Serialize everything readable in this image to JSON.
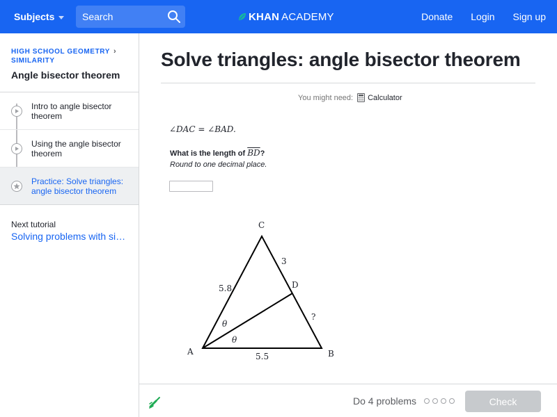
{
  "header": {
    "subjects_label": "Subjects",
    "search_placeholder": "Search",
    "logo_khan": "KHAN",
    "logo_academy": "ACADEMY",
    "donate": "Donate",
    "login": "Login",
    "signup": "Sign up"
  },
  "sidebar": {
    "breadcrumb_line1": "HIGH SCHOOL GEOMETRY",
    "breadcrumb_line2": "SIMILARITY",
    "title": "Angle bisector theorem",
    "items": [
      {
        "label": "Intro to angle bisector theorem",
        "icon": "play-icon",
        "active": false
      },
      {
        "label": "Using the angle bisector theorem",
        "icon": "play-icon",
        "active": false
      },
      {
        "label": "Practice: Solve triangles: angle bisector theorem",
        "icon": "star-icon",
        "active": true
      }
    ],
    "next_label": "Next tutorial",
    "next_link": "Solving problems with similar and congruent triangles"
  },
  "main": {
    "title": "Solve triangles: angle bisector theorem",
    "you_might_need": "You might need:",
    "calculator": "Calculator",
    "equation": "∠DAC = ∠BAD.",
    "question_prefix": "What is the length of ",
    "question_segment": "BD",
    "question_suffix": "?",
    "instruction": "Round to one decimal place.",
    "answer_value": "",
    "figure": {
      "vertex_a": "A",
      "vertex_b": "B",
      "vertex_c": "C",
      "vertex_d": "D",
      "side_ac": "5.8",
      "side_cd": "3",
      "side_db": "?",
      "side_ab": "5.5",
      "angle_1": "θ",
      "angle_2": "θ"
    }
  },
  "footer": {
    "do_problems": "Do 4 problems",
    "check_label": "Check"
  },
  "colors": {
    "brand_blue": "#1865f2",
    "check_disabled": "#c7cacd",
    "scratch_green": "#1fab54"
  }
}
